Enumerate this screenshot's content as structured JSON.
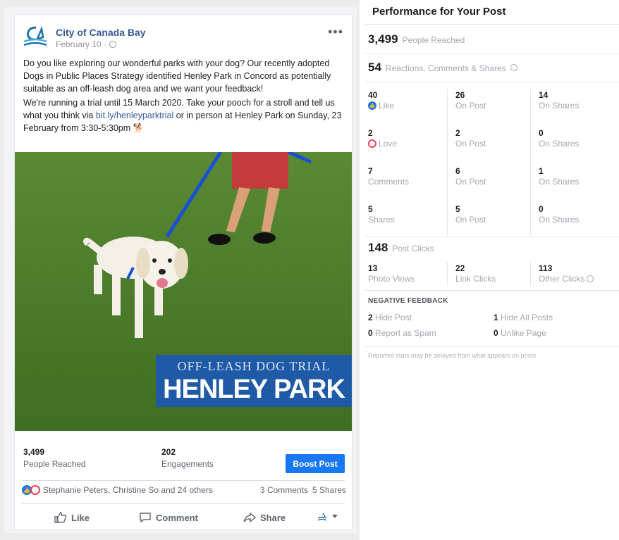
{
  "post": {
    "page_name": "City of Canada Bay",
    "date": "February 10 ·",
    "more": "•••",
    "paragraph1": "Do you like exploring our wonderful parks with your dog? Our recently adopted Dogs in Public Places Strategy identified Henley Park in Concord as potentially suitable as an off-leash dog area and we want your feedback!",
    "paragraph2_a": "We're running a trial until 15 March 2020. Take your pooch for a stroll and tell us what you think via ",
    "paragraph2_link": "bit.ly/henleyparktrial",
    "paragraph2_b": " or in person at Henley Park on Sunday, 23 February from 3:30-5:30pm ",
    "emoji": "🐕",
    "banner_sub": "OFF-LEASH DOG TRIAL",
    "banner_main": "HENLEY PARK",
    "reached_num": "3,499",
    "reached_lbl": "People Reached",
    "engagements_num": "202",
    "engagements_lbl": "Engagements",
    "boost_label": "Boost Post",
    "reaction_names": "Stephanie Peters, Christine So and 24 others",
    "comments": "3 Comments",
    "shares": "5 Shares",
    "like_label": "Like",
    "comment_label": "Comment",
    "share_label": "Share"
  },
  "panel": {
    "title": "Performance for Your Post",
    "people_reached_num": "3,499",
    "people_reached_lbl": "People Reached",
    "reactions_num": "54",
    "reactions_lbl": "Reactions, Comments & Shares",
    "rows": [
      [
        {
          "n": "40",
          "t": "Like"
        },
        {
          "n": "26",
          "t": "On Post"
        },
        {
          "n": "14",
          "t": "On Shares"
        }
      ],
      [
        {
          "n": "2",
          "t": "Love"
        },
        {
          "n": "2",
          "t": "On Post"
        },
        {
          "n": "0",
          "t": "On Shares"
        }
      ],
      [
        {
          "n": "7",
          "t": "Comments"
        },
        {
          "n": "6",
          "t": "On Post"
        },
        {
          "n": "1",
          "t": "On Shares"
        }
      ],
      [
        {
          "n": "5",
          "t": "Shares"
        },
        {
          "n": "5",
          "t": "On Post"
        },
        {
          "n": "0",
          "t": "On Shares"
        }
      ]
    ],
    "clicks_num": "148",
    "clicks_lbl": "Post Clicks",
    "clicks": [
      {
        "n": "13",
        "t": "Photo Views"
      },
      {
        "n": "22",
        "t": "Link Clicks"
      },
      {
        "n": "113",
        "t": "Other Clicks"
      }
    ],
    "negative_title": "NEGATIVE FEEDBACK",
    "neg": [
      {
        "n": "2",
        "t": "Hide Post"
      },
      {
        "n": "1",
        "t": "Hide All Posts"
      },
      {
        "n": "0",
        "t": "Report as Spam"
      },
      {
        "n": "0",
        "t": "Unlike Page"
      }
    ],
    "footnote": "Reported stats may be delayed from what appears on posts"
  },
  "colors": {
    "brand": "#1877f2",
    "link": "#385898",
    "banner": "#1f5aa6",
    "love": "#f33e58"
  }
}
